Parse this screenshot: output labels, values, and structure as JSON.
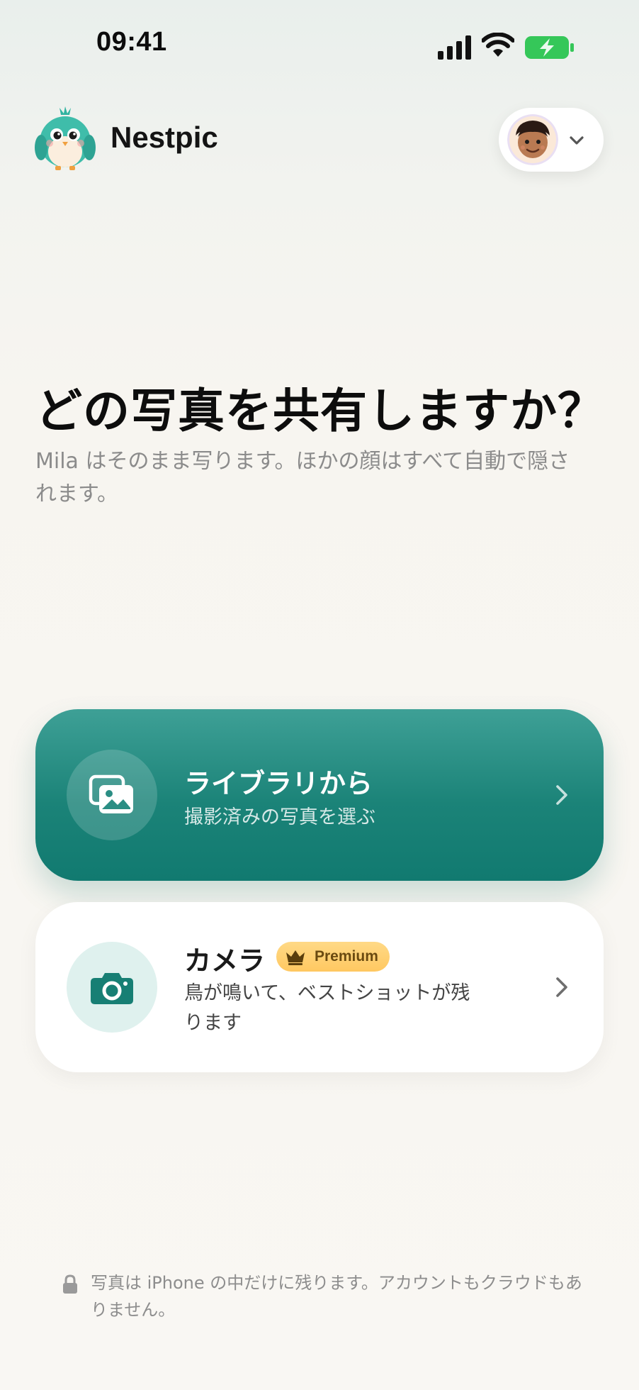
{
  "status_bar": {
    "time": "09:41"
  },
  "header": {
    "app_name": "Nestpic",
    "logo_icon": "bird-mascot-icon",
    "profile_menu_icon": "chevron-down-icon"
  },
  "main": {
    "title": "どの写真を共有しますか？",
    "subtitle": "Mila はそのまま写ります。ほかの顔はすべて自動で隠されます。"
  },
  "options": [
    {
      "title": "ライブラリから",
      "subtitle": "撮影済みの写真を選ぶ",
      "icon": "photo-library-icon"
    },
    {
      "title": "カメラ",
      "badge": "Premium",
      "subtitle": "鳥が鳴いて、ベストショットが残ります",
      "icon": "camera-icon"
    }
  ],
  "footer": {
    "note": "写真は iPhone の中だけに残ります。アカウントもクラウドもありません。",
    "icon": "lock-icon"
  },
  "colors": {
    "accent": "#1b8378",
    "premium": "#ffc861"
  }
}
